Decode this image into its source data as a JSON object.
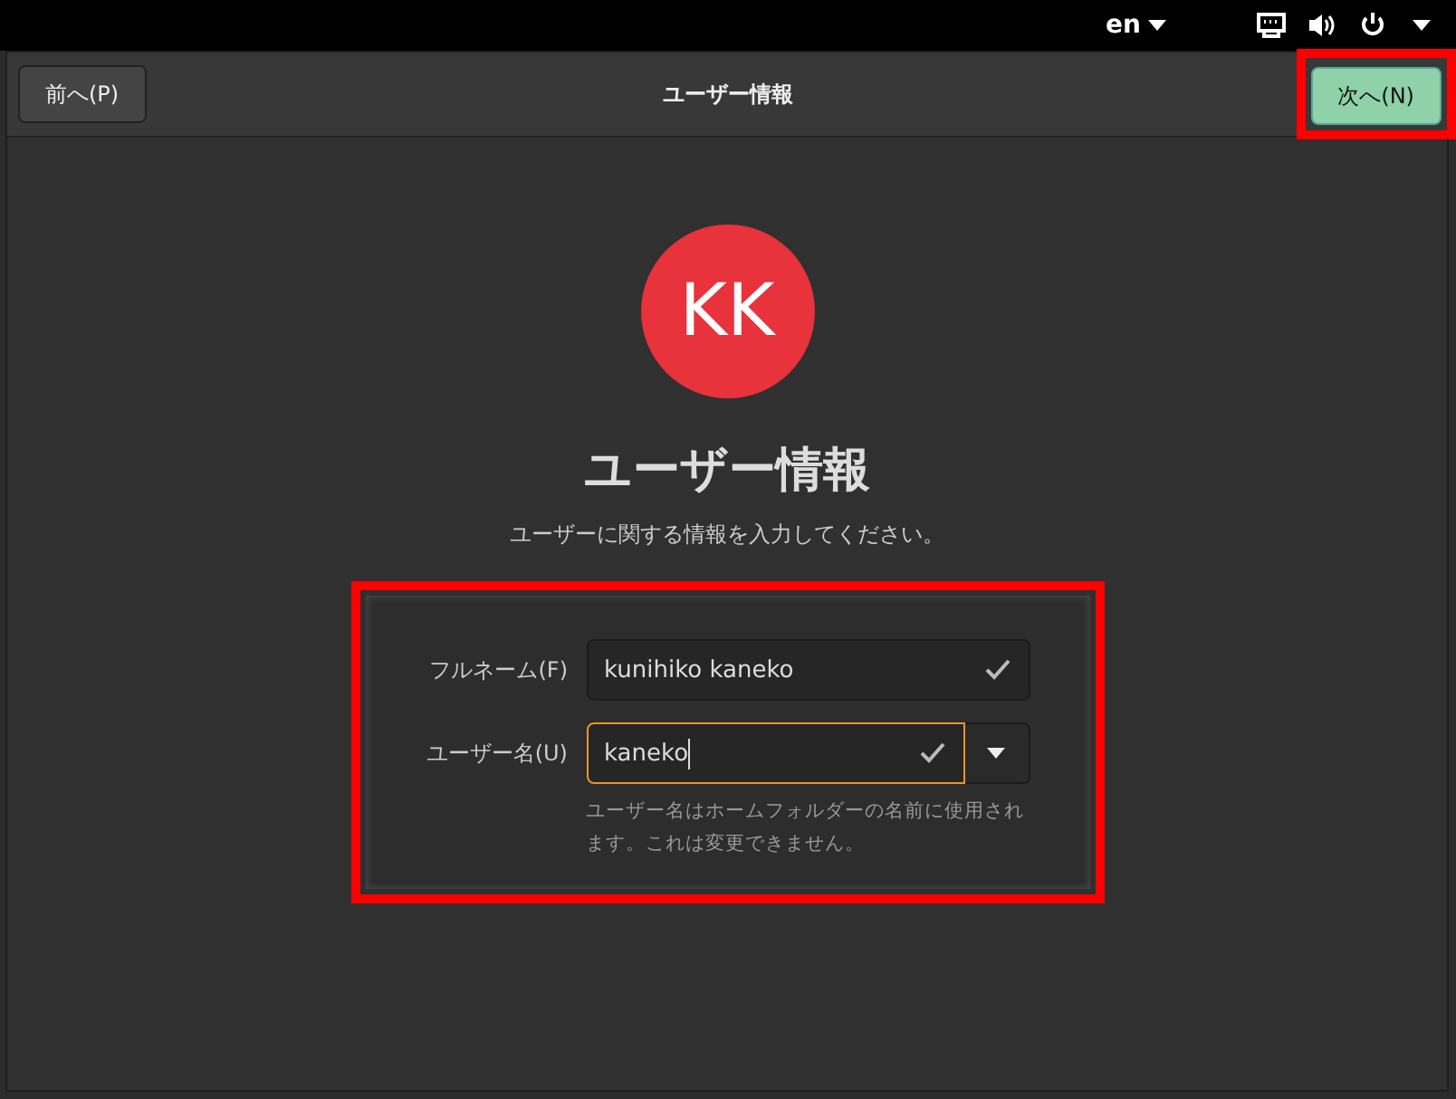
{
  "top_bar": {
    "language": "en"
  },
  "header": {
    "title": "ユーザー情報",
    "back_button": {
      "label": "前へ(P)",
      "highlighted": false
    },
    "next_button": {
      "label": "次へ(N)",
      "highlighted": true
    }
  },
  "avatar": {
    "initials": "KK",
    "color": "#e8323c"
  },
  "heading": "ユーザー情報",
  "subtitle": "ユーザーに関する情報を入力してください。",
  "form": {
    "highlighted": true,
    "fields": [
      {
        "label": "フルネーム(F)",
        "value": "kunihiko kaneko",
        "valid": true,
        "focused": false,
        "dropdown": false
      },
      {
        "label": "ユーザー名(U)",
        "value": "kaneko",
        "valid": true,
        "focused": true,
        "dropdown": true
      }
    ],
    "hint": "ユーザー名はホームフォルダーの名前に使用されます。これは変更できません。"
  }
}
